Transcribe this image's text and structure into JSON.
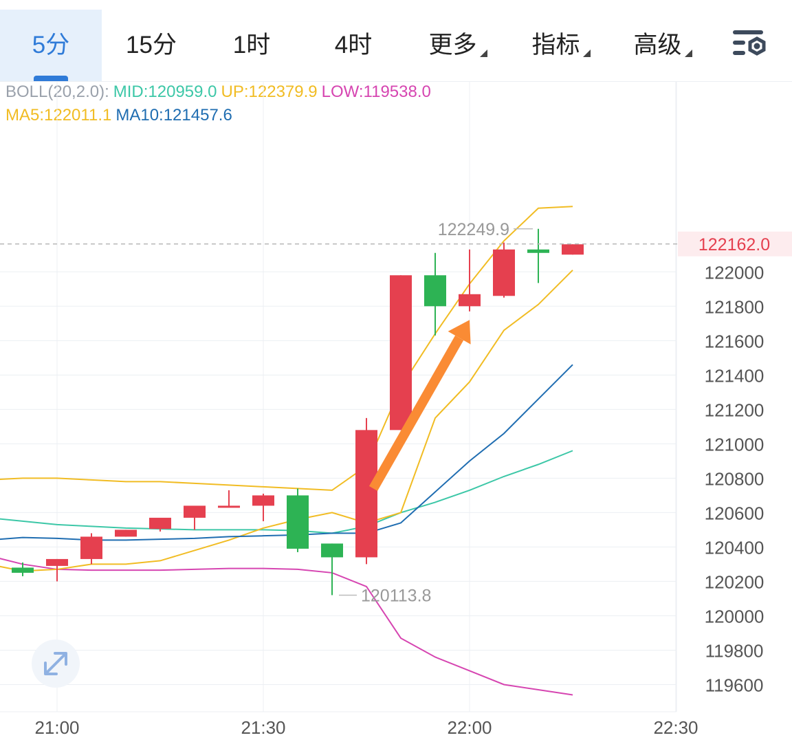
{
  "tabs": [
    {
      "label": "5分",
      "active": true,
      "dropdown": false
    },
    {
      "label": "15分",
      "active": false,
      "dropdown": false
    },
    {
      "label": "1时",
      "active": false,
      "dropdown": false
    },
    {
      "label": "4时",
      "active": false,
      "dropdown": false
    },
    {
      "label": "更多",
      "active": false,
      "dropdown": true
    },
    {
      "label": "指标",
      "active": false,
      "dropdown": true
    },
    {
      "label": "高级",
      "active": false,
      "dropdown": true
    }
  ],
  "toolbar": {
    "settings_icon": "settings-gear-icon",
    "expand_icon": "expand-arrows-icon"
  },
  "legend": {
    "boll_label": "BOLL(20,2.0):",
    "mid": "MID:120959.0",
    "up": "UP:122379.9",
    "low": "LOW:119538.0",
    "ma5": "MA5:122011.1",
    "ma10": "MA10:121457.6"
  },
  "colors": {
    "up": "#e5404f",
    "down": "#2db354",
    "mid": "#3cc7a7",
    "boll_band": "#f1bc23",
    "low": "#d645b1",
    "ma5": "#f1bc23",
    "ma10": "#1f6db1",
    "arrow": "#fa8b34",
    "accent": "#2f7bd8",
    "grid": "#eceff3",
    "axis_text": "#555555",
    "label_text": "#999999"
  },
  "chart_data": {
    "type": "candlestick",
    "x_ticks": [
      "21:00",
      "21:30",
      "22:00",
      "22:30"
    ],
    "y_ticks": [
      122000,
      121800,
      121600,
      121400,
      121200,
      121000,
      120800,
      120600,
      120400,
      120200,
      120000,
      119800,
      119600
    ],
    "ylim": [
      119490,
      122325
    ],
    "current_price": 122162.0,
    "current_price_label": "122162.0",
    "high_label": "122249.9",
    "low_label": "120113.8",
    "candles": [
      {
        "time": "20:50",
        "open": 120225,
        "high": 120290,
        "low": 120225,
        "close": 120260
      },
      {
        "time": "20:55",
        "open": 120280,
        "high": 120310,
        "low": 120230,
        "close": 120250
      },
      {
        "time": "21:00",
        "open": 120290,
        "high": 120330,
        "low": 120200,
        "close": 120330
      },
      {
        "time": "21:05",
        "open": 120330,
        "high": 120480,
        "low": 120300,
        "close": 120460
      },
      {
        "time": "21:10",
        "open": 120460,
        "high": 120500,
        "low": 120460,
        "close": 120500
      },
      {
        "time": "21:15",
        "open": 120505,
        "high": 120550,
        "low": 120490,
        "close": 120570
      },
      {
        "time": "21:20",
        "open": 120570,
        "high": 120605,
        "low": 120500,
        "close": 120640
      },
      {
        "time": "21:25",
        "open": 120640,
        "high": 120730,
        "low": 120630,
        "close": 120640
      },
      {
        "time": "21:30",
        "open": 120640,
        "high": 120710,
        "low": 120550,
        "close": 120700
      },
      {
        "time": "21:35",
        "open": 120700,
        "high": 120740,
        "low": 120370,
        "close": 120390
      },
      {
        "time": "21:40",
        "open": 120420,
        "high": 120420,
        "low": 120120,
        "close": 120340
      },
      {
        "time": "21:45",
        "open": 120340,
        "high": 121150,
        "low": 120300,
        "close": 121080
      },
      {
        "time": "21:50",
        "open": 121080,
        "high": 121980,
        "low": 121080,
        "close": 121980
      },
      {
        "time": "21:55",
        "open": 121980,
        "high": 122110,
        "low": 121630,
        "close": 121800
      },
      {
        "time": "22:00",
        "open": 121800,
        "high": 122130,
        "low": 121770,
        "close": 121870
      },
      {
        "time": "22:05",
        "open": 121860,
        "high": 122170,
        "low": 121850,
        "close": 122130
      },
      {
        "time": "22:10",
        "open": 122130,
        "high": 122250,
        "low": 121935,
        "close": 122110
      },
      {
        "time": "22:15",
        "open": 122100,
        "high": 122160,
        "low": 122100,
        "close": 122160
      }
    ],
    "series": [
      {
        "name": "MID",
        "values": [
          120570,
          120550,
          120530,
          120520,
          120510,
          120505,
          120500,
          120500,
          120500,
          120495,
          120480,
          120520,
          120600,
          120660,
          120730,
          120810,
          120880,
          120960
        ]
      },
      {
        "name": "UP",
        "values": [
          120790,
          120800,
          120800,
          120790,
          120780,
          120780,
          120770,
          120760,
          120750,
          120740,
          120730,
          120870,
          121330,
          121640,
          121930,
          122180,
          122370,
          122380
        ]
      },
      {
        "name": "LOW",
        "values": [
          120350,
          120300,
          120270,
          120265,
          120265,
          120265,
          120270,
          120275,
          120275,
          120270,
          120250,
          120170,
          119870,
          119760,
          119680,
          119600,
          119570,
          119540
        ]
      },
      {
        "name": "MA5",
        "values": [
          120300,
          120260,
          120270,
          120300,
          120300,
          120320,
          120380,
          120440,
          120510,
          120560,
          120600,
          120540,
          120600,
          121150,
          121360,
          121660,
          121810,
          122010
        ]
      },
      {
        "name": "MA10",
        "values": [
          120440,
          120455,
          120450,
          120440,
          120440,
          120445,
          120450,
          120460,
          120465,
          120470,
          120480,
          120480,
          120540,
          120720,
          120900,
          121060,
          121260,
          121460
        ]
      }
    ],
    "annotation": {
      "type": "arrow",
      "from": {
        "time": "21:46",
        "price": 120740
      },
      "to": {
        "time": "22:00",
        "price": 121720
      }
    }
  }
}
